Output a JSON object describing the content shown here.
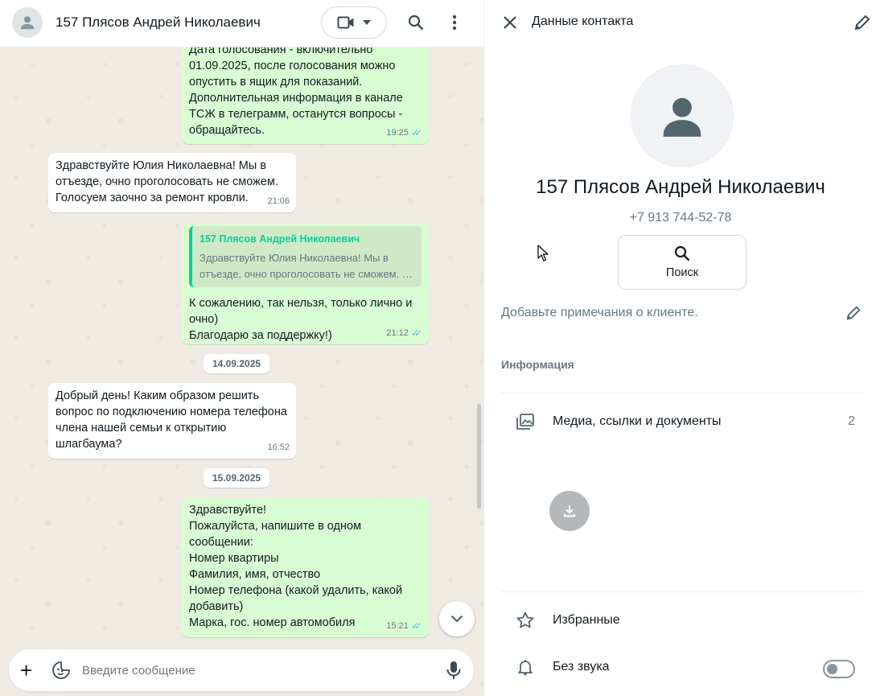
{
  "chat": {
    "title": "157 Плясов Андрей Николаевич",
    "composer_placeholder": "Введите сообщение",
    "messages": [
      {
        "lines": [
          "Дата голосования - включительно",
          "01.09.2025, после голосования можно",
          "опустить в ящик для показаний.",
          "Дополнительная информация в канале",
          "ТСЖ в телеграмм, останутся вопросы -",
          "обращайтесь."
        ],
        "time": "19:25"
      },
      {
        "lines": [
          "Здравствуйте Юлия Николаевна! Мы в",
          "отъезде, очно проголосовать не сможем.",
          "Голосуем заочно за ремонт кровли."
        ],
        "time": "21:06"
      },
      {
        "quote_name": "157 Плясов Андрей Николаевич",
        "quote_lines": [
          "Здравствуйте Юлия Николаевна! Мы в",
          "отъезде, очно проголосовать не сможем.  …"
        ],
        "lines": [
          "К сожалению, так нельзя, только лично и",
          "очно)",
          "Благодарю за поддержку!)"
        ],
        "time": "21:12"
      },
      {
        "lines": [
          "Добрый день! Каким образом решить",
          "вопрос по подключению номера телефона",
          "члена нашей семьи к открытию",
          "шлагбаума?"
        ],
        "time": "16:52"
      },
      {
        "lines": [
          "Здравствуйте!",
          "Пожалуйста, напишите в одном",
          "сообщении:",
          "Номер квартиры",
          "Фамилия, имя, отчество",
          "Номер телефона (какой удалить, какой",
          "добавить)",
          "Марка, гос. номер автомобиля"
        ],
        "time": "15:21"
      }
    ],
    "dates": [
      "14.09.2025",
      "15.09.2025"
    ]
  },
  "contact": {
    "header_title": "Данные контакта",
    "name": "157 Плясов Андрей Николаевич",
    "phone": "+7 913 744-52-78",
    "search_label": "Поиск",
    "notes_placeholder": "Добавьте примечания о клиенте.",
    "section_info": "Информация",
    "media_label": "Медиа, ссылки и документы",
    "media_count": "2",
    "favorites_label": "Избранные",
    "mute_label": "Без звука",
    "mute_on": false
  },
  "colors": {
    "outgoing": "#d9fdd3",
    "incoming": "#ffffff",
    "accent": "#06cf9c",
    "read_tick": "#53bdeb"
  }
}
